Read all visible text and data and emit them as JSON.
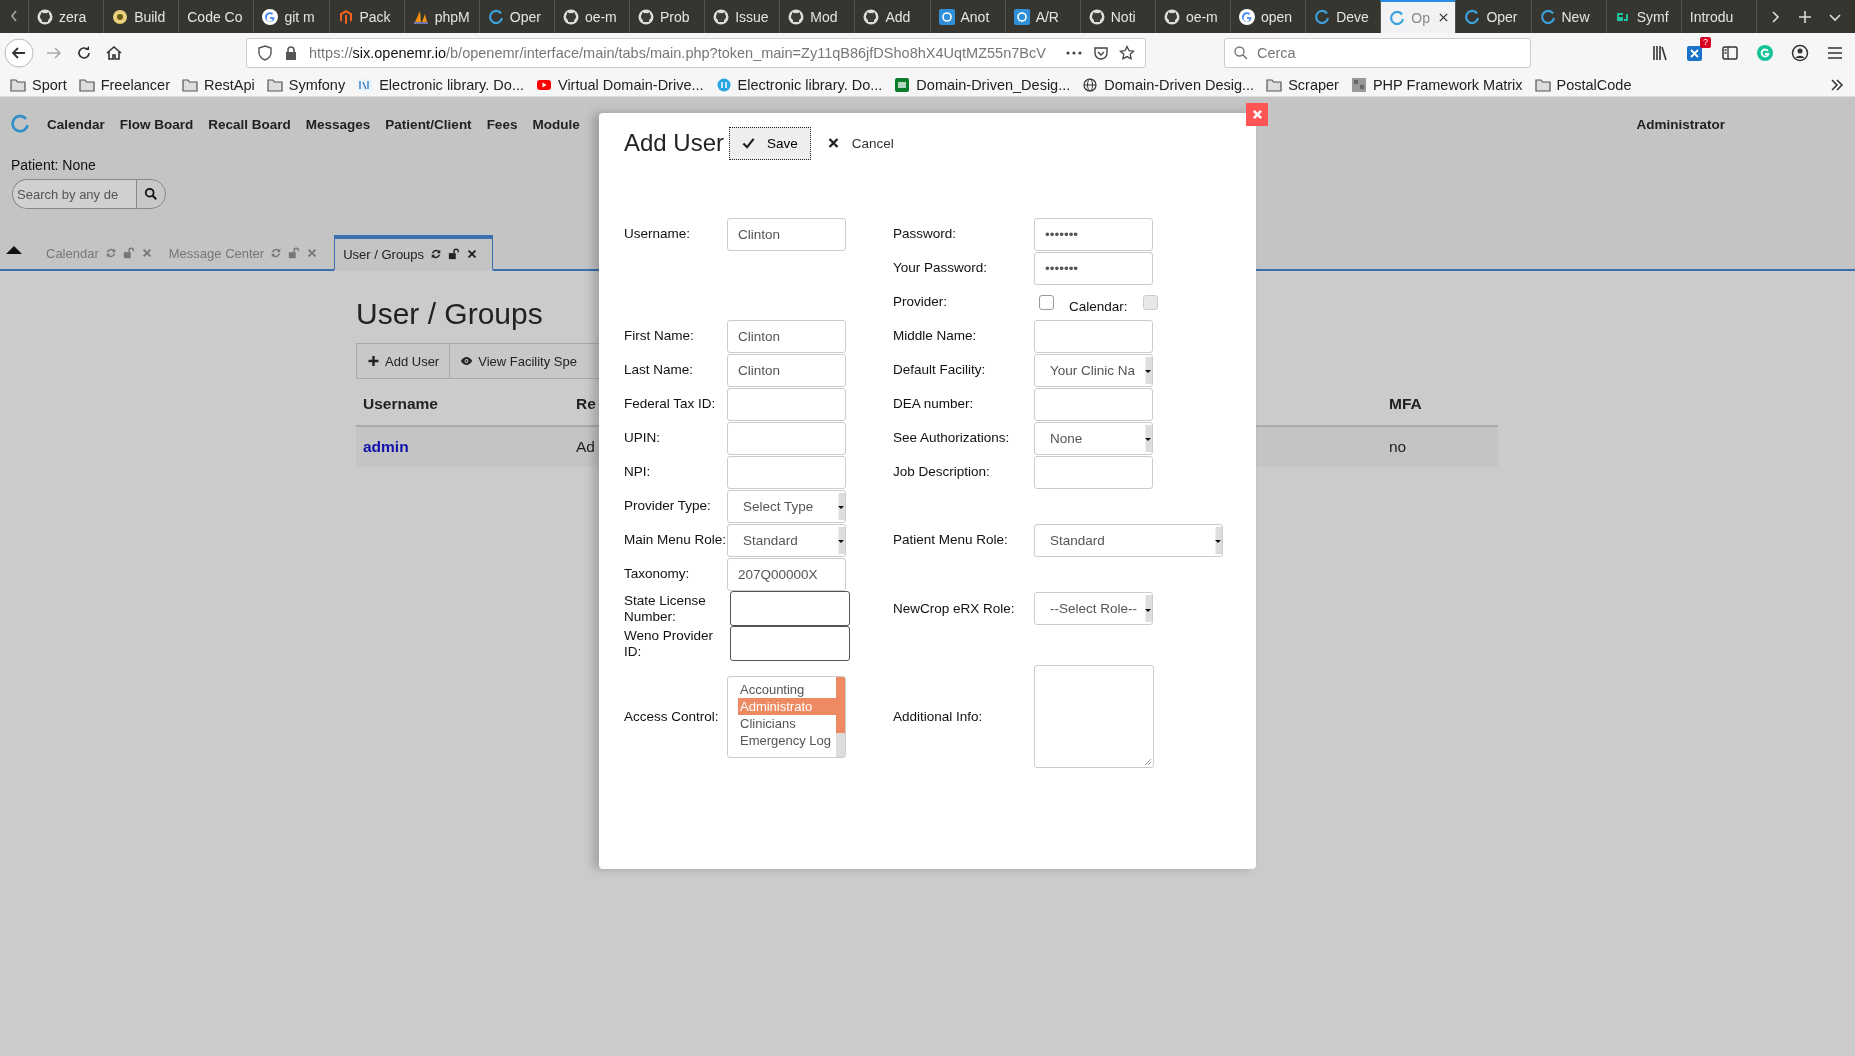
{
  "browser": {
    "tabs": [
      {
        "title": "zera",
        "kind": "github",
        "selected": false
      },
      {
        "title": "Build",
        "kind": "build",
        "selected": false
      },
      {
        "title": "Code Co",
        "kind": "none",
        "selected": false
      },
      {
        "title": "git m",
        "kind": "google",
        "selected": false
      },
      {
        "title": "Pack",
        "kind": "magento",
        "selected": false
      },
      {
        "title": "phpM",
        "kind": "sails",
        "selected": false
      },
      {
        "title": "Oper",
        "kind": "openemr",
        "selected": false
      },
      {
        "title": "oe-m",
        "kind": "github",
        "selected": false
      },
      {
        "title": "Prob",
        "kind": "github",
        "selected": false
      },
      {
        "title": "Issue",
        "kind": "github",
        "selected": false
      },
      {
        "title": "Mod",
        "kind": "github",
        "selected": false
      },
      {
        "title": "Add",
        "kind": "github",
        "selected": false
      },
      {
        "title": "Anot",
        "kind": "square",
        "selected": false
      },
      {
        "title": "A/R",
        "kind": "square",
        "selected": false
      },
      {
        "title": "Noti",
        "kind": "github",
        "selected": false
      },
      {
        "title": "oe-m",
        "kind": "github",
        "selected": false
      },
      {
        "title": "open",
        "kind": "google",
        "selected": false
      },
      {
        "title": "Deve",
        "kind": "openemr",
        "selected": false
      },
      {
        "title": "Op",
        "kind": "openemr",
        "selected": true
      },
      {
        "title": "Oper",
        "kind": "openemr",
        "selected": false
      },
      {
        "title": "New",
        "kind": "openemr",
        "selected": false
      },
      {
        "title": "Symf",
        "kind": "symfony",
        "selected": false
      },
      {
        "title": "Introdu",
        "kind": "none",
        "selected": false
      }
    ],
    "address": {
      "scheme": "https://",
      "domain": "six.openemr.io",
      "path": "/b/openemr/interface/main/tabs/main.php?token_main=Zy11qB86jfDSho8hX4UqtMZ55n7BcV"
    },
    "search": {
      "placeholder": "Cerca"
    },
    "extension_badge": "?",
    "bookmarks": [
      {
        "label": "Sport",
        "kind": "folder"
      },
      {
        "label": "Freelancer",
        "kind": "folder"
      },
      {
        "label": "RestApi",
        "kind": "folder"
      },
      {
        "label": "Symfony",
        "kind": "folder"
      },
      {
        "label": "Electronic library. Do...",
        "kind": "library"
      },
      {
        "label": "Virtual Domain-Drive...",
        "kind": "video"
      },
      {
        "label": "Electronic library. Do...",
        "kind": "circle"
      },
      {
        "label": "Domain-Driven_Desig...",
        "kind": "green"
      },
      {
        "label": "Domain-Driven Desig...",
        "kind": "globe"
      },
      {
        "label": "Scraper",
        "kind": "folder"
      },
      {
        "label": "PHP Framework Matrix",
        "kind": "image"
      },
      {
        "label": "PostalCode",
        "kind": "folder"
      }
    ]
  },
  "app": {
    "nav": [
      "Calendar",
      "Flow Board",
      "Recall Board",
      "Messages",
      "Patient/Client",
      "Fees",
      "Module"
    ],
    "user": "Administrator",
    "patient": "Patient: None",
    "search": {
      "placeholder": "Search by any de"
    },
    "tabs": [
      {
        "label": "Calendar",
        "selected": false
      },
      {
        "label": "Message Center",
        "selected": false
      },
      {
        "label": "User / Groups",
        "selected": true
      }
    ]
  },
  "page": {
    "title": "User / Groups",
    "buttons": [
      {
        "label": "Add User",
        "kind": "add"
      },
      {
        "label": "View Facility Spe",
        "kind": "view"
      }
    ],
    "table": {
      "columns": [
        "Username",
        "Re",
        "MFA"
      ],
      "rows": [
        [
          "admin",
          "Ad",
          "no"
        ]
      ]
    }
  },
  "dialog": {
    "title": "Add User",
    "save": "Save",
    "cancel": "Cancel",
    "rows": [
      {
        "left": {
          "label": "Username:",
          "kind": "text",
          "value": "Clinton"
        },
        "right": {
          "label": "Password:",
          "kind": "text",
          "value": "•••••••"
        }
      },
      {
        "right": {
          "label": "Your Password:",
          "kind": "text",
          "value": "•••••••"
        }
      },
      {
        "right": {
          "label": "Provider:",
          "kind": "checkbox",
          "checked": false,
          "extra": {
            "label": "Calendar:",
            "checked": false,
            "disabled": true
          }
        }
      },
      {
        "left": {
          "label": "First Name:",
          "kind": "text",
          "value": "Clinton"
        },
        "right": {
          "label": "Middle Name:",
          "kind": "text"
        }
      },
      {
        "left": {
          "label": "Last Name:",
          "kind": "text",
          "value": "Clinton"
        },
        "right": {
          "label": "Default Facility:",
          "kind": "select",
          "value": "Your Clinic Na"
        }
      },
      {
        "left": {
          "label": "Federal Tax ID:",
          "kind": "text"
        },
        "right": {
          "label": "DEA number:",
          "kind": "text"
        }
      },
      {
        "left": {
          "label": "UPIN:",
          "kind": "text"
        },
        "right": {
          "label": "See Authorizations:",
          "kind": "select",
          "value": "None"
        }
      },
      {
        "left": {
          "label": "NPI:",
          "kind": "text"
        },
        "right": {
          "label": "Job Description:",
          "kind": "text"
        }
      },
      {
        "left": {
          "label": "Provider Type:",
          "kind": "select",
          "value": "Select Type"
        }
      },
      {
        "left": {
          "label": "Main Menu Role:",
          "kind": "select",
          "value": "Standard"
        },
        "right": {
          "label": "Patient Menu Role:",
          "kind": "wideselect",
          "value": "Standard"
        }
      },
      {
        "left": {
          "label": "Taxonomy:",
          "kind": "text",
          "value": "207Q00000X"
        }
      },
      {
        "left": {
          "label": "State License Number:",
          "kind": "plain"
        },
        "right": {
          "label": "NewCrop eRX Role:",
          "kind": "select",
          "value": "--Select Role--"
        }
      },
      {
        "left": {
          "label": "Weno Provider ID:",
          "kind": "plain"
        }
      },
      {
        "left": {
          "label": "Access Control:",
          "kind": "listbox",
          "items": [
            {
              "label": "Accounting",
              "selected": false
            },
            {
              "label": "Administrato",
              "selected": true
            },
            {
              "label": "Clinicians",
              "selected": false
            },
            {
              "label": "Emergency Log",
              "selected": false
            }
          ]
        },
        "right": {
          "label": "Additional Info:",
          "kind": "textarea"
        }
      }
    ]
  }
}
